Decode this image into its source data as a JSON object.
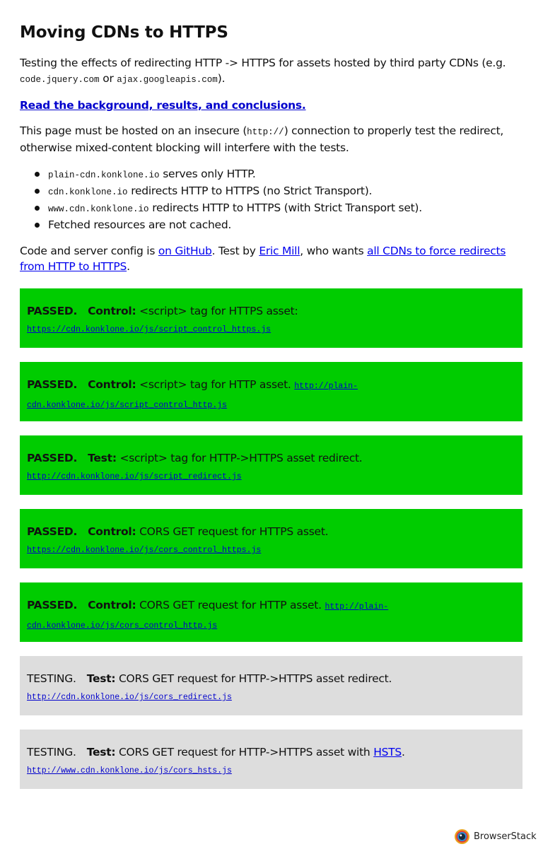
{
  "title": "Moving CDNs to HTTPS",
  "intro": {
    "text": "Testing the effects of redirecting HTTP -> HTTPS for assets hosted by third party CDNs (e.g. ",
    "code1": "code.jquery.com",
    "or": " or ",
    "code2": "ajax.googleapis.com",
    "end": ")."
  },
  "background_link": "Read the background, results, and conclusions.",
  "insecure": {
    "before": "This page must be hosted on an insecure (",
    "code": "http://",
    "after": ") connection to properly test the redirect, otherwise mixed-content blocking will interfere with the tests."
  },
  "bullets": [
    {
      "code": "plain-cdn.konklone.io",
      "text": " serves only HTTP."
    },
    {
      "code": "cdn.konklone.io",
      "text": " redirects HTTP to HTTPS (no Strict Transport)."
    },
    {
      "code": "www.cdn.konklone.io",
      "text": " redirects HTTP to HTTPS (with Strict Transport set)."
    },
    {
      "code": "",
      "text": "Fetched resources are not cached."
    }
  ],
  "credits": {
    "t1": "Code and server config is ",
    "link1": "on GitHub",
    "t2": ". Test by ",
    "link2": "Eric Mill",
    "t3": ", who wants ",
    "link3": "all CDNs to force redirects from HTTP to HTTPS",
    "t4": "."
  },
  "tests": [
    {
      "status": "PASSED.",
      "kind": "Control:",
      "desc": " <script> tag for HTTPS asset:",
      "link": "",
      "link_suffix": "",
      "url": "https://cdn.konklone.io/js/script_control_https.js"
    },
    {
      "status": "PASSED.",
      "kind": "Control:",
      "desc": " <script> tag for HTTP asset.",
      "link": "",
      "link_suffix": "",
      "url": "http://plain-cdn.konklone.io/js/script_control_http.js"
    },
    {
      "status": "PASSED.",
      "kind": "Test:",
      "desc": " <script> tag for HTTP->HTTPS asset redirect.",
      "link": "",
      "link_suffix": "",
      "url": "http://cdn.konklone.io/js/script_redirect.js"
    },
    {
      "status": "PASSED.",
      "kind": "Control:",
      "desc": " CORS GET request for HTTPS asset.",
      "link": "",
      "link_suffix": "",
      "url": "https://cdn.konklone.io/js/cors_control_https.js"
    },
    {
      "status": "PASSED.",
      "kind": "Control:",
      "desc": " CORS GET request for HTTP asset.",
      "link": "",
      "link_suffix": "",
      "url": "http://plain-cdn.konklone.io/js/cors_control_http.js"
    },
    {
      "status": "TESTING.",
      "kind": "Test:",
      "desc": " CORS GET request for HTTP->HTTPS asset redirect.",
      "link": "",
      "link_suffix": "",
      "url": "http://cdn.konklone.io/js/cors_redirect.js"
    },
    {
      "status": "TESTING.",
      "kind": "Test:",
      "desc": " CORS GET request for HTTP->HTTPS asset with ",
      "link": "HSTS",
      "link_suffix": ".",
      "url": "http://www.cdn.konklone.io/js/cors_hsts.js"
    }
  ],
  "badge": {
    "text": "BrowserStack",
    "icon": "browserstack-logo-icon"
  },
  "colors": {
    "passed": "#00cc00",
    "testing": "#dddddd",
    "link": "#0000ee"
  }
}
